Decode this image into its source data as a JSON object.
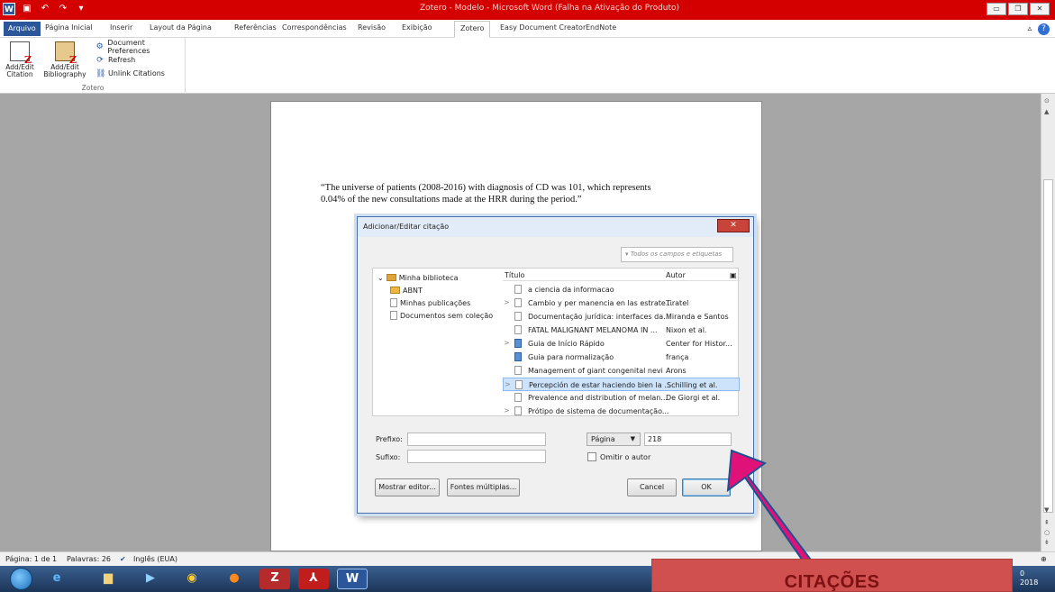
{
  "window": {
    "title": "Zotero - Modelo - Microsoft Word (Falha na Ativação do Produto)"
  },
  "ribbon": {
    "tabs": [
      "Arquivo",
      "Página Inicial",
      "Inserir",
      "Layout da Página",
      "Referências",
      "Correspondências",
      "Revisão",
      "Exibição",
      "Zotero",
      "Easy Document Creator",
      "EndNote"
    ],
    "active_tab": "Zotero",
    "zotero_group": {
      "add_edit_citation": "Add/Edit Citation",
      "add_edit_bibliography": "Add/Edit Bibliography",
      "document_preferences": "Document Preferences",
      "refresh": "Refresh",
      "unlink_citations": "Unlink Citations",
      "group_label": "Zotero"
    }
  },
  "document": {
    "text_line1": "“The universe of patients (2008-2016) with diagnosis of CD was 101, which represents",
    "text_line2": "0.04% of the new consultations made at the HRR during the period.”"
  },
  "dialog": {
    "title": "Adicionar/Editar citação",
    "search_placeholder": "▾ Todos os campos e etiquetas",
    "tree": {
      "library": "Minha biblioteca",
      "items": [
        "ABNT",
        "Minhas publicações",
        "Documentos sem coleção"
      ]
    },
    "columns": {
      "title": "Título",
      "author": "Autor"
    },
    "rows": [
      {
        "twisty": "",
        "title": "a ciencia da informacao",
        "author": "",
        "icon": "document",
        "selected": false
      },
      {
        "twisty": ">",
        "title": "Cambio y per manencia en las estrate...",
        "author": "Tiratel",
        "icon": "document",
        "selected": false
      },
      {
        "twisty": "",
        "title": "Documentação jurídica: interfaces da...",
        "author": "Miranda e Santos",
        "icon": "document",
        "selected": false
      },
      {
        "twisty": "",
        "title": "FATAL MALIGNANT MELANOMA IN ...",
        "author": "Nixon et al.",
        "icon": "document",
        "selected": false
      },
      {
        "twisty": ">",
        "title": "Guia de Início Rápido",
        "author": "Center for Histor...",
        "icon": "web-page",
        "selected": false
      },
      {
        "twisty": "",
        "title": "Guia para normalização",
        "author": "frança",
        "icon": "book",
        "selected": false
      },
      {
        "twisty": "",
        "title": "Management of giant congenital nevi",
        "author": "Arons",
        "icon": "document",
        "selected": false
      },
      {
        "twisty": ">",
        "title": "Percepción de estar haciendo bien la ...",
        "author": "Schilling et al.",
        "icon": "document",
        "selected": true
      },
      {
        "twisty": "",
        "title": "Prevalence and distribution of melan...",
        "author": "De Giorgi et al.",
        "icon": "document",
        "selected": false
      },
      {
        "twisty": ">",
        "title": "Prótipo de sistema de documentação...",
        "author": "",
        "icon": "document",
        "selected": false
      }
    ],
    "prefix_label": "Prefixo:",
    "prefix_value": "",
    "suffix_label": "Sufixo:",
    "suffix_value": "",
    "locator_select": "Página",
    "locator_value": "218",
    "omit_author_label": "Omitir o autor",
    "omit_author_checked": false,
    "show_editor_button": "Mostrar editor...",
    "multiple_sources_button": "Fontes múltiplas...",
    "cancel_button": "Cancel",
    "ok_button": "OK"
  },
  "status_bar": {
    "page": "Página: 1 de 1",
    "words": "Palavras: 26",
    "language": "Inglês (EUA)"
  },
  "clock": {
    "line1": "0",
    "line2": "2018"
  },
  "annotation": {
    "banner_text": "CITAÇÕES",
    "banner_color": "#d0504f",
    "arrow_color": "#e0127a"
  }
}
